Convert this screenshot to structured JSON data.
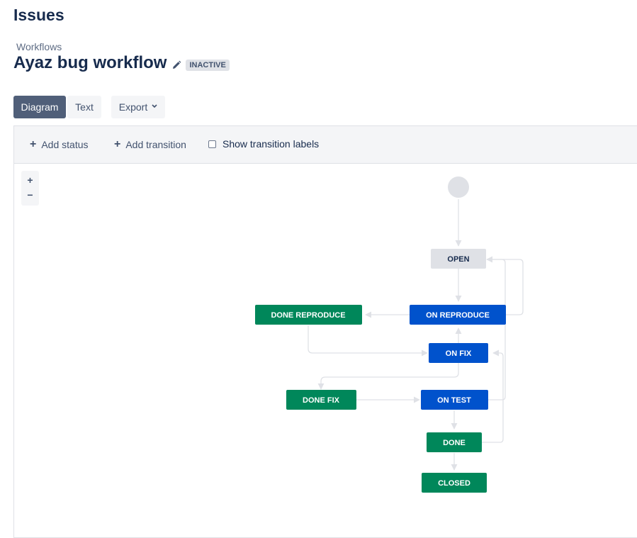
{
  "page": {
    "heading": "Issues"
  },
  "breadcrumb": {
    "label": "Workflows"
  },
  "workflow": {
    "title": "Ayaz bug workflow",
    "status_lozenge": "INACTIVE"
  },
  "tabs": {
    "diagram": "Diagram",
    "text": "Text",
    "export": "Export"
  },
  "toolbar": {
    "add_status": "Add status",
    "add_transition": "Add transition",
    "show_labels": "Show transition labels",
    "show_labels_checked": false
  },
  "zoom": {
    "in": "+",
    "out": "−"
  },
  "statuses": {
    "open": "OPEN",
    "on_reproduce": "ON REPRODUCE",
    "done_reproduce": "DONE REPRODUCE",
    "on_fix": "ON FIX",
    "done_fix": "DONE FIX",
    "on_test": "ON TEST",
    "done": "DONE",
    "closed": "CLOSED"
  },
  "colors": {
    "todo": "#dfe1e6",
    "in_progress": "#0052cc",
    "done": "#00875a",
    "transition": "#dfe1e6",
    "initial": "#dfe1e6"
  },
  "icons": {
    "edit": "pencil-icon",
    "export_dropdown": "chevron-down-icon",
    "add": "plus-icon"
  }
}
